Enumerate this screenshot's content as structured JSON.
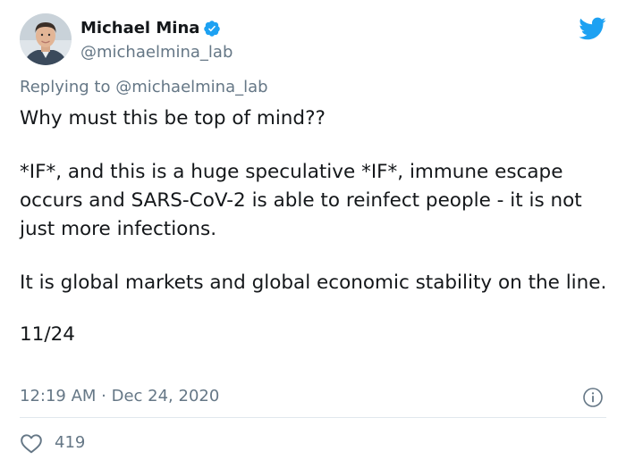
{
  "author": {
    "display_name": "Michael Mina",
    "handle": "@michaelmina_lab",
    "verified": true,
    "avatar_icon": "profile-photo"
  },
  "brand": {
    "logo_icon": "twitter-bird-icon",
    "accent_color": "#1da1f2"
  },
  "reply_context": {
    "prefix": "Replying to ",
    "mention": "@michaelmina_lab"
  },
  "tweet": {
    "paragraphs": [
      "Why must this be top of mind??",
      "*IF*, and this is a huge speculative *IF*, immune escape occurs and SARS-CoV-2 is able to reinfect people - it is not just more  infections.",
      "It is global markets and global economic stability on the line.",
      "11/24"
    ]
  },
  "meta": {
    "timestamp": "12:19 AM · Dec 24, 2020",
    "info_icon": "info-icon"
  },
  "actions": {
    "like_icon": "heart-icon",
    "like_count": "419"
  }
}
